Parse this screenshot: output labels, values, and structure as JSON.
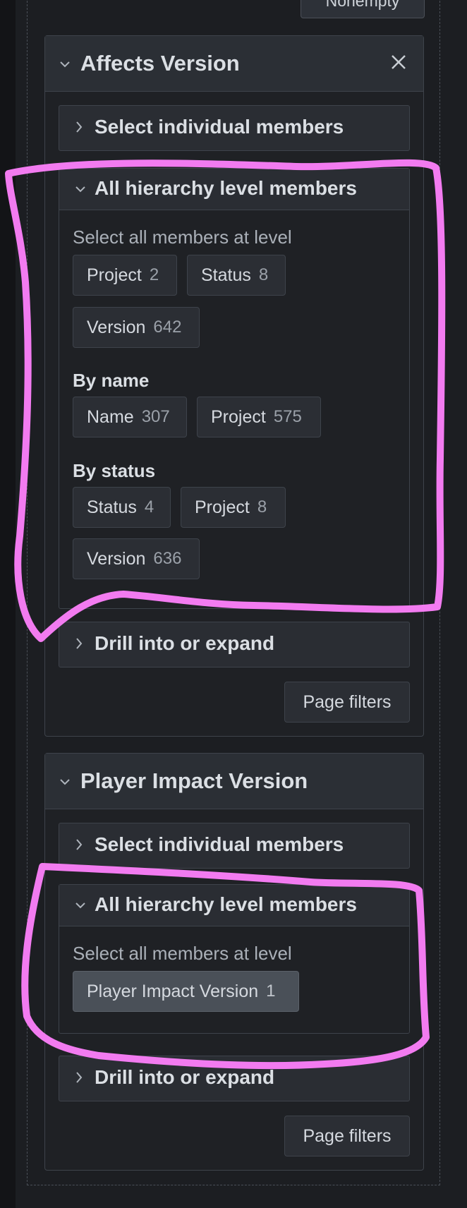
{
  "top_button": {
    "label": "Nonempty"
  },
  "panels": [
    {
      "title": "Affects Version",
      "sections": {
        "select_individual": "Select individual members",
        "all_hierarchy": "All hierarchy level members",
        "drill": "Drill into or expand"
      },
      "hint": "Select all members at level",
      "level_chips": [
        {
          "label": "Project",
          "count": "2"
        },
        {
          "label": "Status",
          "count": "8"
        },
        {
          "label": "Version",
          "count": "642"
        }
      ],
      "by_name": {
        "label": "By name",
        "chips": [
          {
            "label": "Name",
            "count": "307"
          },
          {
            "label": "Project",
            "count": "575"
          }
        ]
      },
      "by_status": {
        "label": "By status",
        "chips": [
          {
            "label": "Status",
            "count": "4"
          },
          {
            "label": "Project",
            "count": "8"
          },
          {
            "label": "Version",
            "count": "636"
          }
        ]
      },
      "page_filters": "Page filters"
    },
    {
      "title": "Player Impact Version",
      "sections": {
        "select_individual": "Select individual members",
        "all_hierarchy": "All hierarchy level members",
        "drill": "Drill into or expand"
      },
      "hint": "Select all members at level",
      "level_chips": [
        {
          "label": "Player Impact Version",
          "count": "1"
        }
      ],
      "page_filters": "Page filters"
    }
  ],
  "colors": {
    "annotation": "#f27bf0",
    "background": "#1c1e22",
    "panel_header": "#2b2f35"
  }
}
